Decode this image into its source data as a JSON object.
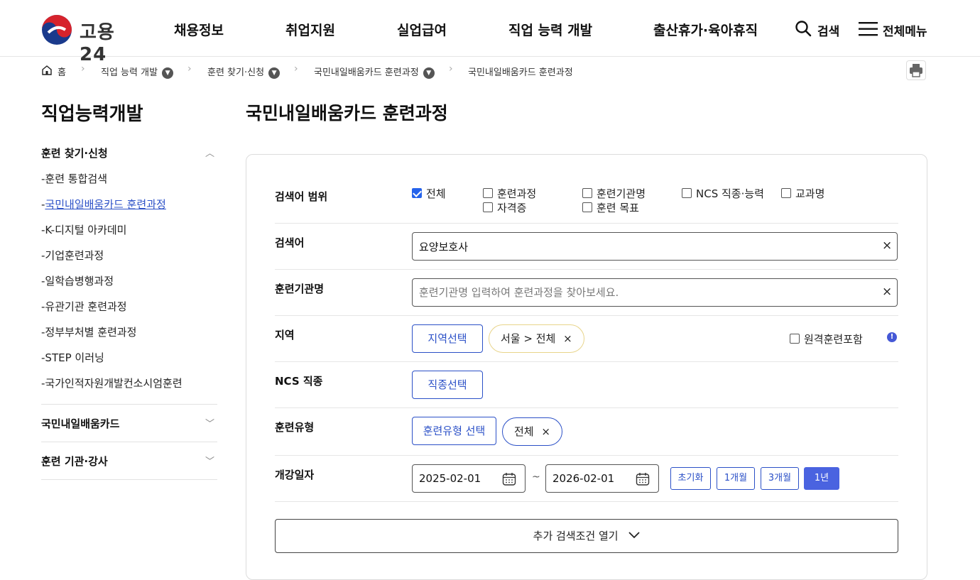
{
  "header": {
    "logo_text": "고용24",
    "nav": [
      "채용정보",
      "취업지원",
      "실업급여",
      "직업 능력 개발",
      "출산휴가·육아휴직"
    ],
    "search_label": "검색",
    "menu_label": "전체메뉴"
  },
  "breadcrumb": [
    "홈",
    "직업 능력 개발",
    "훈련 찾기·신청",
    "국민내일배움카드 훈련과정",
    "국민내일배움카드 훈련과정"
  ],
  "sidebar": {
    "title": "직업능력개발",
    "groups": [
      {
        "label": "훈련 찾기·신청",
        "expanded": true
      },
      {
        "label": "국민내일배움카드",
        "expanded": false
      },
      {
        "label": "훈련 기관·강사",
        "expanded": false
      }
    ],
    "sub_items": [
      "훈련 통합검색",
      "국민내일배움카드 훈련과정",
      "K-디지털 아카데미",
      "기업훈련과정",
      "일학습병행과정",
      "유관기관 훈련과정",
      "정부부처별 훈련과정",
      "STEP 이러닝",
      "국가인적자원개발컨소시엄훈련"
    ],
    "active_index": 1
  },
  "main": {
    "title": "국민내일배움카드 훈련과정"
  },
  "form": {
    "scope": {
      "label": "검색어 범위",
      "options": [
        {
          "label": "전체",
          "checked": true
        },
        {
          "label": "훈련과정",
          "checked": false
        },
        {
          "label": "훈련기관명",
          "checked": false
        },
        {
          "label": "NCS 직종·능력",
          "checked": false
        },
        {
          "label": "교과명",
          "checked": false
        },
        {
          "label": "자격증",
          "checked": false
        },
        {
          "label": "훈련 목표",
          "checked": false
        }
      ]
    },
    "keyword": {
      "label": "검색어",
      "value": "요양보호사"
    },
    "institution": {
      "label": "훈련기관명",
      "value": "",
      "placeholder": "훈련기관명 입력하여 훈련과정을 찾아보세요."
    },
    "region": {
      "label": "지역",
      "button": "지역선택",
      "tag": "서울 > 전체",
      "remote_label": "원격훈련포함",
      "remote_checked": false,
      "info_icon": "!"
    },
    "ncs": {
      "label": "NCS 직종",
      "button": "직종선택"
    },
    "training_type": {
      "label": "훈련유형",
      "button": "훈련유형 선택",
      "tag": "전체"
    },
    "date": {
      "label": "개강일자",
      "start": "2025-02-01",
      "separator": "~",
      "end": "2026-02-01",
      "periods": [
        "초기화",
        "1개월",
        "3개월",
        "1년"
      ],
      "active_period": "1년"
    },
    "more_button": "추가 검색조건 열기",
    "clear_symbol": "×"
  },
  "colors": {
    "accent": "#2b50c7",
    "accent_fill": "#4a63e0",
    "tag_border": "#e8d48a",
    "checkbox": "#2563eb"
  }
}
